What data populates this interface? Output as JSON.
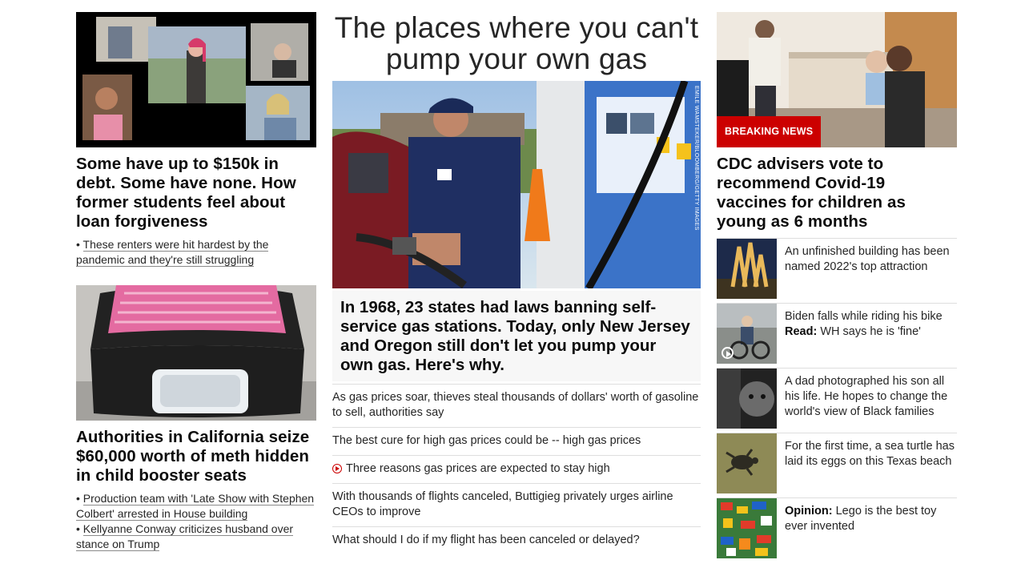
{
  "left": {
    "story1": {
      "headline": "Some have up to $150k in debt. Some have none. How former students feel about loan forgiveness",
      "related": [
        "These renters were hit hardest by the pandemic and they're still struggling"
      ]
    },
    "story2": {
      "headline": "Authorities in California seize $60,000 worth of meth hidden in child booster seats",
      "related": [
        "Production team with 'Late Show with Stephen Colbert' arrested in House building",
        "Kellyanne Conway criticizes husband over stance on Trump"
      ]
    }
  },
  "middle": {
    "title": "The places where you can't pump your own gas",
    "photo_credit": "EMILE WAMSTEKER/BLOOMBERG/GETTY IMAGES",
    "lede": "In 1968, 23 states had laws banning self-service gas stations. Today, only New Jersey and Oregon still don't let you pump your own gas. Here's why.",
    "links": [
      "As gas prices soar, thieves steal thousands of dollars' worth of gasoline to sell, authorities say",
      "The best cure for high gas prices could be -- high gas prices",
      "Three reasons gas prices are expected to stay high",
      "With thousands of flights canceled, Buttigieg privately urges airline CEOs to improve",
      "What should I do if my flight has been canceled or delayed?"
    ]
  },
  "right": {
    "badge": "BREAKING NEWS",
    "headline": "CDC advisers vote to recommend Covid-19 vaccines for children as young as 6 months",
    "items": [
      {
        "bold": "",
        "text": "An unfinished building has been named 2022's top attraction"
      },
      {
        "bold": "",
        "text": "Biden falls while riding his bike",
        "bold2": "Read:",
        "text2": " WH says he is 'fine'"
      },
      {
        "bold": "",
        "text": "A dad photographed his son all his life. He hopes to change the world's view of Black families"
      },
      {
        "bold": "",
        "text": "For the first time, a sea turtle has laid its eggs on this Texas beach"
      },
      {
        "bold": "Opinion:",
        "text": " Lego is the best toy ever invented"
      }
    ]
  },
  "colors": {
    "accent": "#cc0000",
    "divider": "#dedede",
    "lede_bg": "#f7f7f7"
  }
}
